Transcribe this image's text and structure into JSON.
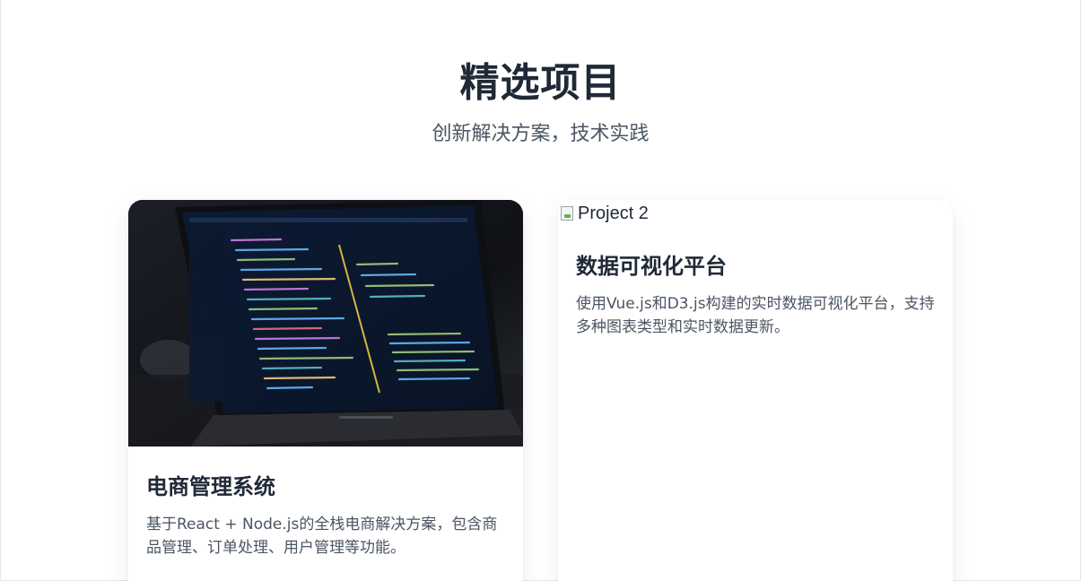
{
  "section": {
    "title": "精选项目",
    "subtitle": "创新解决方案，技术实践"
  },
  "projects": [
    {
      "image_alt": "Project 1",
      "title": "电商管理系统",
      "description": "基于React + Node.js的全栈电商解决方案，包含商品管理、订单处理、用户管理等功能。"
    },
    {
      "image_alt": "Project 2",
      "title": "数据可视化平台",
      "description": "使用Vue.js和D3.js构建的实时数据可视化平台，支持多种图表类型和实时数据更新。"
    }
  ],
  "colors": {
    "title": "#1f2937",
    "body_text": "#4b5563",
    "card_bg": "#ffffff"
  }
}
